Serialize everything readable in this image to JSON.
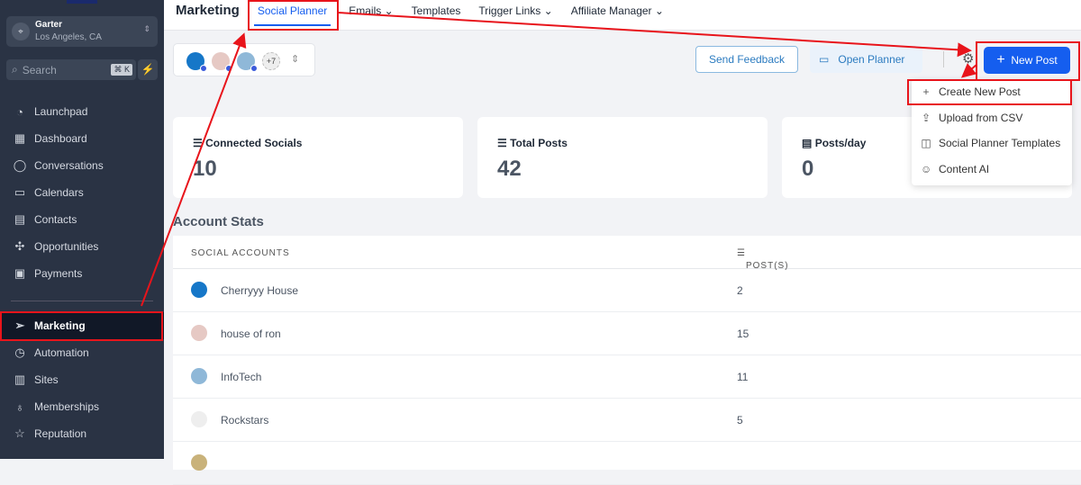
{
  "sidebar": {
    "location_name": "Garter",
    "location_city": "Los Angeles, CA",
    "search_placeholder": "Search",
    "search_shortcut": "⌘ K",
    "items": [
      {
        "label": "Launchpad",
        "icon": "rocket-icon"
      },
      {
        "label": "Dashboard",
        "icon": "grid-icon"
      },
      {
        "label": "Conversations",
        "icon": "chat-icon"
      },
      {
        "label": "Calendars",
        "icon": "calendar-icon"
      },
      {
        "label": "Contacts",
        "icon": "contacts-icon"
      },
      {
        "label": "Opportunities",
        "icon": "funnel-icon"
      },
      {
        "label": "Payments",
        "icon": "payments-icon"
      },
      {
        "label": "Marketing",
        "icon": "send-icon",
        "active": true
      },
      {
        "label": "Automation",
        "icon": "automation-icon"
      },
      {
        "label": "Sites",
        "icon": "sites-icon"
      },
      {
        "label": "Memberships",
        "icon": "award-icon"
      },
      {
        "label": "Reputation",
        "icon": "star-icon"
      }
    ]
  },
  "topbar": {
    "title": "Marketing",
    "tabs": [
      "Social Planner",
      "Emails",
      "Templates",
      "Trigger Links",
      "Affiliate Manager"
    ]
  },
  "toolbar": {
    "more_accounts": "+7",
    "send_feedback": "Send Feedback",
    "open_planner": "Open Planner",
    "new_post": "New Post"
  },
  "menu": [
    "Create New Post",
    "Upload from CSV",
    "Social Planner Templates",
    "Content AI"
  ],
  "cards": [
    {
      "label": "Connected Socials",
      "value": "10"
    },
    {
      "label": "Total Posts",
      "value": "42"
    },
    {
      "label": "Posts/day",
      "value": "0"
    }
  ],
  "stats": {
    "title": "Account Stats",
    "col_accounts": "SOCIAL ACCOUNTS",
    "col_posts": "POST(S)",
    "rows": [
      {
        "name": "Cherryyy House",
        "posts": "2"
      },
      {
        "name": "house of ron",
        "posts": "15"
      },
      {
        "name": "InfoTech",
        "posts": "11"
      },
      {
        "name": "Rockstars",
        "posts": "5"
      }
    ]
  },
  "colors": {
    "accent": "#155eef",
    "annotation": "#e8141b",
    "sidebar": "#2a3344"
  }
}
